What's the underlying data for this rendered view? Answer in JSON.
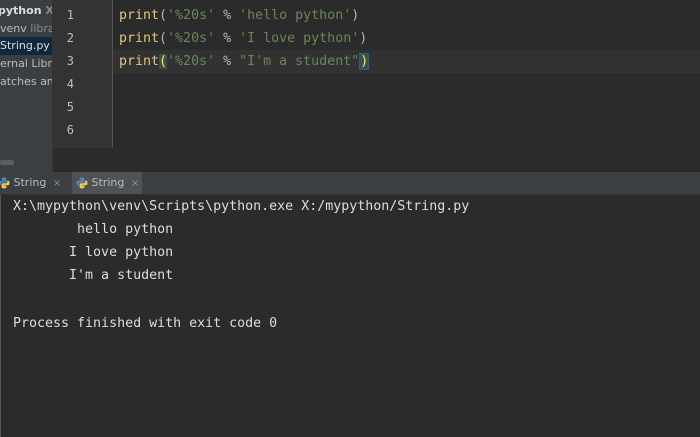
{
  "project": {
    "root_label": "python",
    "root_suffix": "X:",
    "venv_label": "venv",
    "venv_suffix": "librar",
    "file_label": "String.py",
    "external_label": "ernal Librar",
    "scratches_label": "atches and"
  },
  "editor": {
    "line_numbers": [
      "1",
      "2",
      "3",
      "4",
      "5",
      "6"
    ],
    "lines": [
      {
        "fn": "print",
        "open": "(",
        "str": "'%20s'",
        "op": " % ",
        "arg": "'hello python'",
        "close": ")"
      },
      {
        "fn": "print",
        "open": "(",
        "str": "'%20s'",
        "op": " % ",
        "arg": "'I love python'",
        "close": ")"
      },
      {
        "fn": "print",
        "open": "(",
        "str": "'%20s'",
        "op": " % ",
        "arg": "\"I'm a student\"",
        "close": ")"
      }
    ]
  },
  "run_tabs": [
    {
      "label": "String",
      "close": "×",
      "icon": "python-icon"
    },
    {
      "label": "String",
      "close": "×",
      "icon": "python-icon"
    }
  ],
  "console": {
    "command": "X:\\mypython\\venv\\Scripts\\python.exe X:/mypython/String.py",
    "output": [
      "        hello python",
      "       I love python",
      "       I'm a student"
    ],
    "exit_message": "Process finished with exit code 0"
  },
  "colors": {
    "background": "#2b2b2b",
    "keyword_fn": "#e0c57a",
    "string": "#6a8759",
    "text": "#a9b7c6"
  }
}
